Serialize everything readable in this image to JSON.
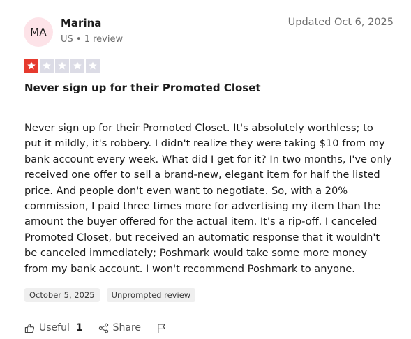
{
  "reviewer": {
    "initials": "MA",
    "name": "Marina",
    "meta": "US • 1 review"
  },
  "updated": "Updated Oct 6, 2025",
  "rating": {
    "value": 1,
    "max": 5,
    "filled_color": "#e63a2e",
    "empty_color": "#dcdce6"
  },
  "review": {
    "title": "Never sign up for their Promoted Closet",
    "body_lines": [
      "Never sign up for their Promoted Closet. It's absolutely worthless; to",
      "put it mildly, it's robbery. I didn't realize they were taking $10 from my",
      "bank account every week. What did I get for it? In two months, I've only",
      "received one offer to sell a brand-new, elegant item for half the listed",
      "price. And people don't even want to negotiate. So, with a 20%",
      "commission, I paid three times more for advertising my item than the",
      "amount the buyer offered for the actual item. It's a rip-off. I canceled",
      "Promoted Closet, but received an automatic response that it wouldn't",
      "be canceled immediately; Poshmark would take some more money",
      "from my bank account. I won't recommend Poshmark to anyone."
    ]
  },
  "tags": [
    "October 5, 2025",
    "Unprompted review"
  ],
  "actions": {
    "useful_label": "Useful",
    "useful_count": "1",
    "share_label": "Share",
    "icons": [
      "thumbs-up-icon",
      "share-icon",
      "flag-icon"
    ]
  }
}
